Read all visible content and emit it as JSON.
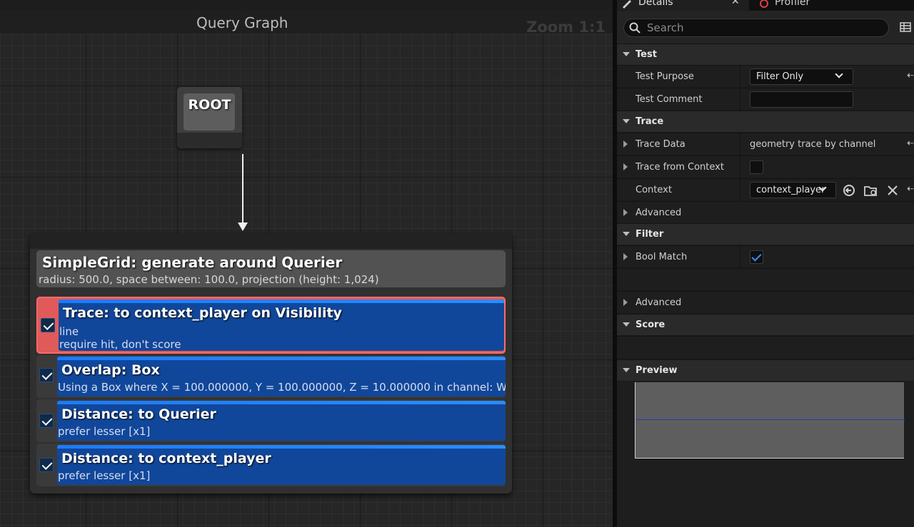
{
  "graph": {
    "title": "Query Graph",
    "zoom": "Zoom 1:1",
    "root_label": "ROOT",
    "generator": {
      "title": "SimpleGrid: generate around Querier",
      "subtitle": "radius: 500.0, space between: 100.0, projection (height: 1,024)",
      "tests": [
        {
          "title": "Trace: to context_player on Visibility",
          "lines": [
            "line",
            "require hit, don't score"
          ],
          "checked": true,
          "selected": true
        },
        {
          "title": "Overlap: Box",
          "lines": [
            "Using a Box where X = 100.000000, Y = 100.000000, Z = 10.000000 in channel: WorldStatic"
          ],
          "checked": true,
          "selected": false
        },
        {
          "title": "Distance: to Querier",
          "lines": [
            "prefer lesser [x1]"
          ],
          "checked": true,
          "selected": false
        },
        {
          "title": "Distance: to context_player",
          "lines": [
            "prefer lesser [x1]"
          ],
          "checked": true,
          "selected": false
        }
      ]
    }
  },
  "details": {
    "tabs": {
      "details": "Details",
      "profiler": "Profiler"
    },
    "search_placeholder": "Search",
    "sections": {
      "test": "Test",
      "trace": "Trace",
      "filter": "Filter",
      "score": "Score",
      "preview": "Preview"
    },
    "props": {
      "test_purpose": {
        "label": "Test Purpose",
        "value": "Filter Only"
      },
      "test_comment": {
        "label": "Test Comment",
        "value": ""
      },
      "trace_data": {
        "label": "Trace Data",
        "value": "geometry trace by channel"
      },
      "trace_from_context": {
        "label": "Trace from Context",
        "checked": false
      },
      "context": {
        "label": "Context",
        "value": "context_player"
      },
      "advanced_trace": {
        "label": "Advanced"
      },
      "bool_match": {
        "label": "Bool Match",
        "checked": true
      },
      "advanced_filter": {
        "label": "Advanced"
      }
    },
    "icons": {
      "search": "search-icon",
      "table": "table-view-icon",
      "use_selected": "use-selected-icon",
      "browse": "browse-folder-icon",
      "clear": "clear-icon",
      "reset": "reset-to-default-icon"
    }
  }
}
